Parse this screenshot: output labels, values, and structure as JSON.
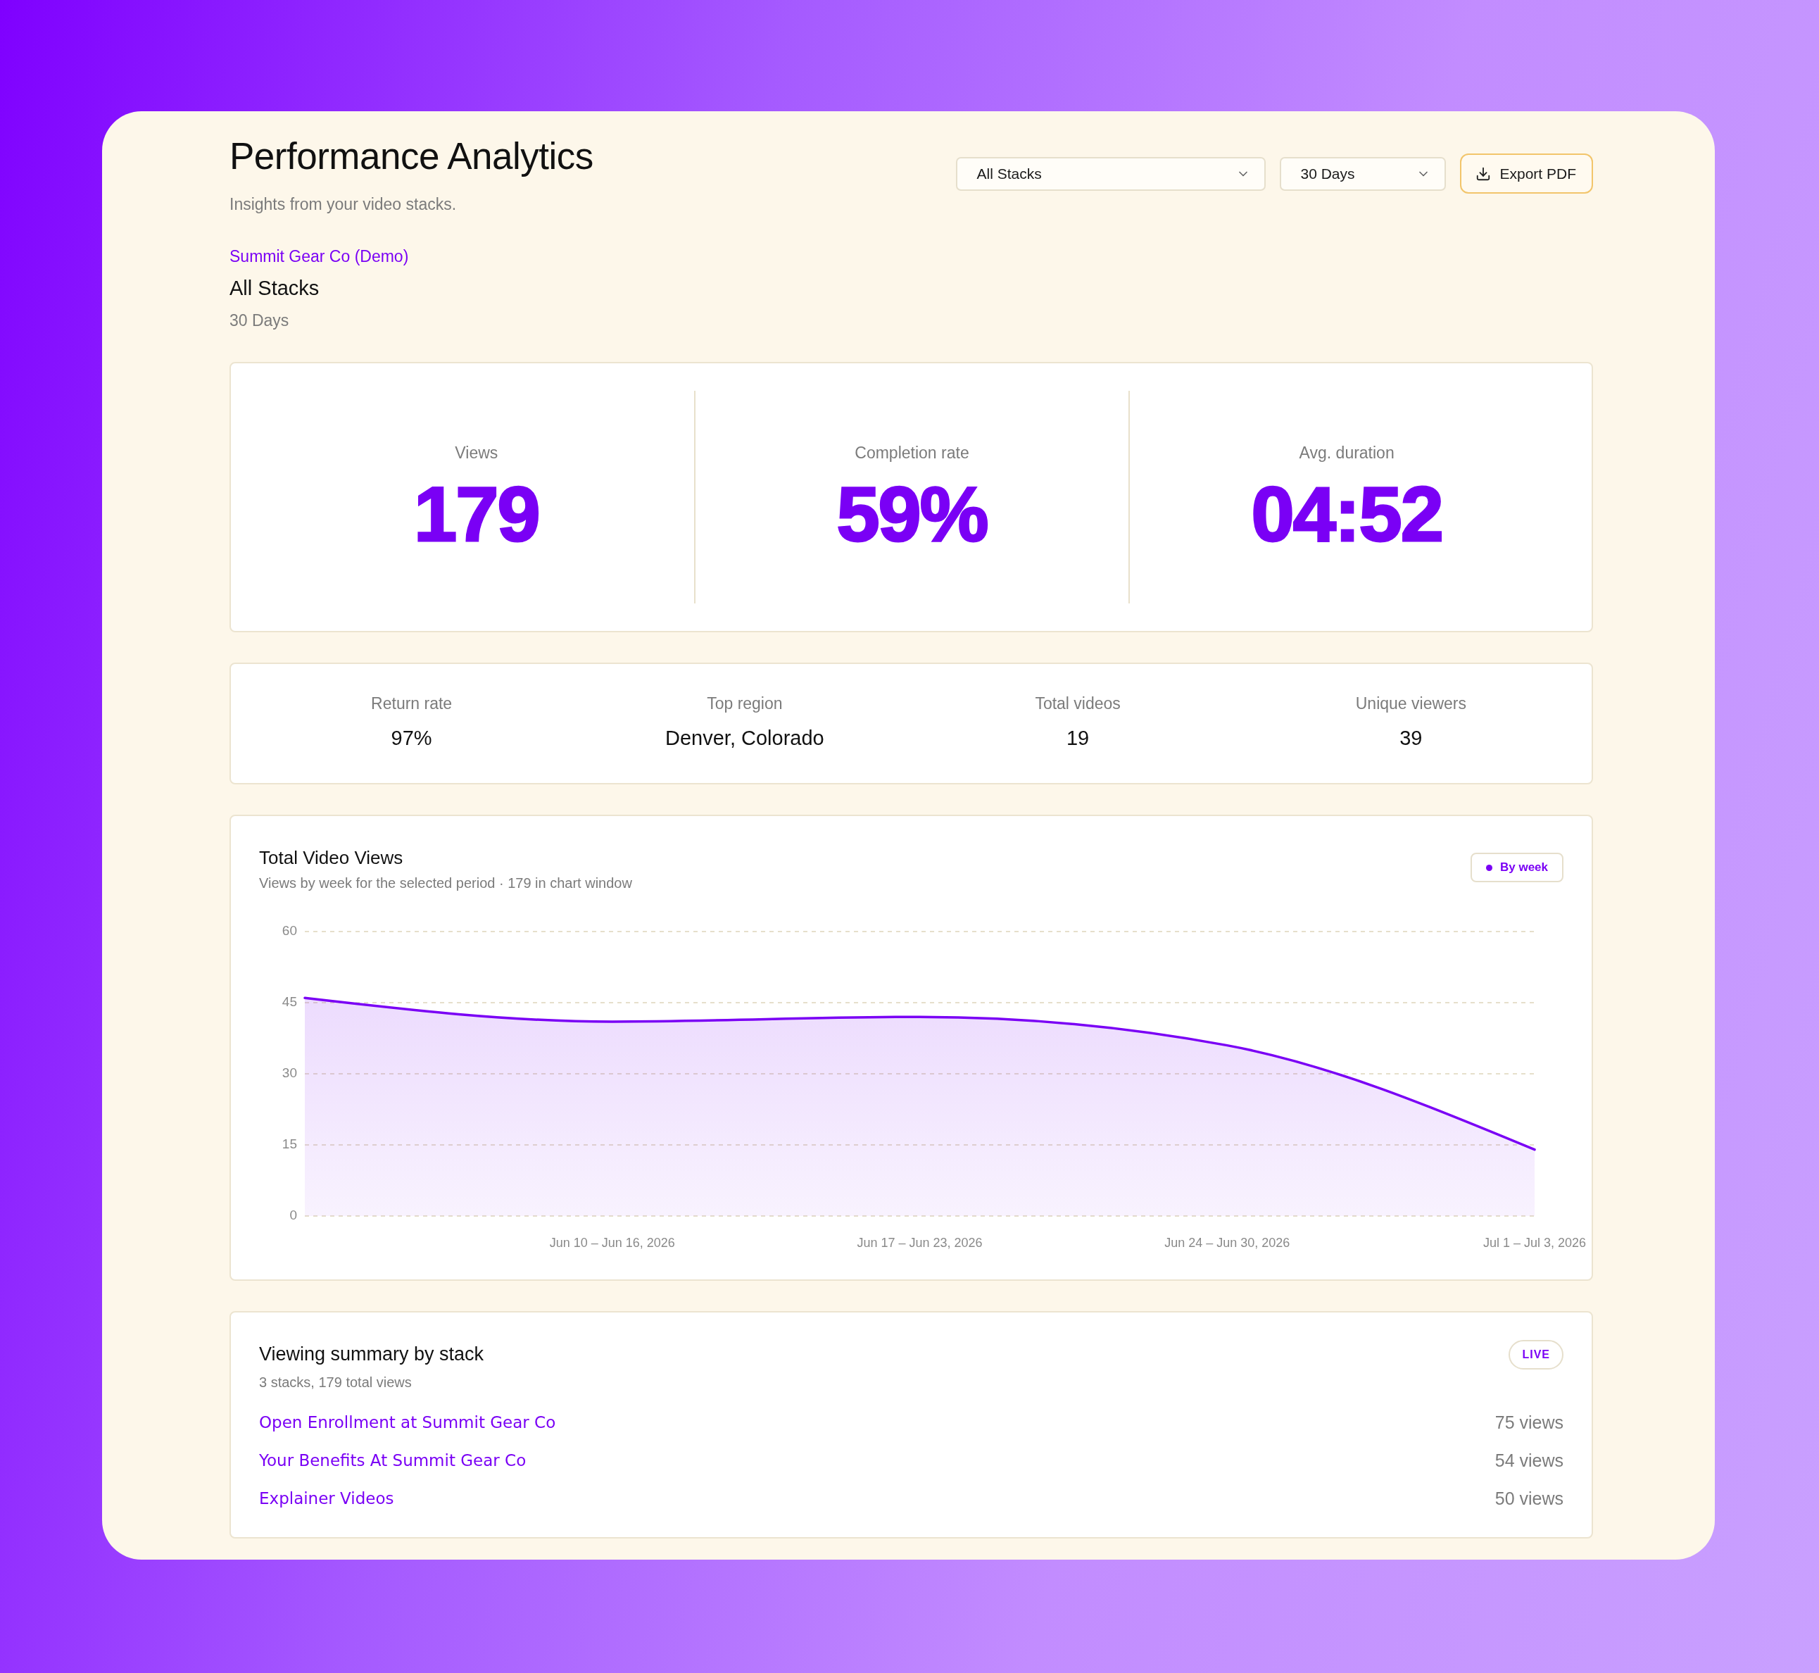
{
  "header": {
    "title": "Performance Analytics",
    "subtitle": "Insights from your video stacks."
  },
  "filters": [
    {
      "value": "All Stacks"
    },
    {
      "value": "30 Days"
    }
  ],
  "export_button": {
    "label": "Export PDF"
  },
  "context": {
    "account": "Summit Gear Co (Demo)",
    "stack": "All Stacks",
    "period": "30 Days"
  },
  "kpis": [
    {
      "label": "Views",
      "value": "179"
    },
    {
      "label": "Completion rate",
      "value": "59%"
    },
    {
      "label": "Avg. duration",
      "value": "04:52"
    }
  ],
  "stats": [
    {
      "label": "Return rate",
      "value": "97%"
    },
    {
      "label": "Top region",
      "value": "Denver, Colorado"
    },
    {
      "label": "Total videos",
      "value": "19"
    },
    {
      "label": "Unique viewers",
      "value": "39"
    }
  ],
  "chart": {
    "title": "Total Video Views",
    "subtitle": "Views by week for the selected period · 179 in chart window",
    "badge": "By week",
    "chart_data": {
      "type": "area",
      "categories": [
        null,
        "Jun 10 – Jun 16, 2026",
        "Jun 17 – Jun 23, 2026",
        "Jun 24 – Jun 30, 2026",
        "Jul 1 – Jul 3, 2026"
      ],
      "series": [
        {
          "color": "#7a00f5",
          "values": [
            46,
            41,
            42,
            36,
            14
          ]
        }
      ],
      "ylim": [
        0,
        60
      ],
      "yticks": [
        0,
        15,
        30,
        45,
        60
      ],
      "grid": true
    }
  },
  "summary": {
    "title": "Viewing summary by stack",
    "subtitle": "3 stacks, 179 total views",
    "badge": "LIVE",
    "rows": [
      {
        "name": "Open Enrollment at Summit Gear Co",
        "views": "75 views"
      },
      {
        "name": "Your Benefits At Summit Gear Co",
        "views": "54 views"
      },
      {
        "name": "Explainer Videos",
        "views": "50 views"
      }
    ]
  }
}
